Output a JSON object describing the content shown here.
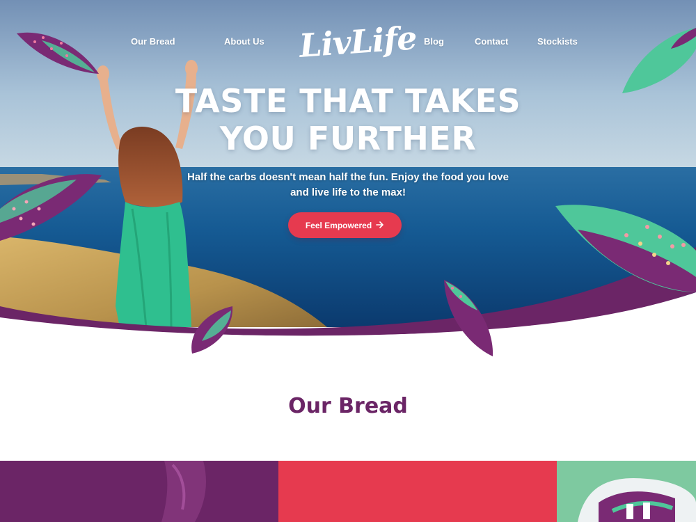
{
  "nav": {
    "left": [
      "Our Bread",
      "About Us"
    ],
    "logo": "LivLife",
    "right": [
      "Blog",
      "Contact",
      "Stockists"
    ]
  },
  "hero": {
    "headline_line1": "TASTE THAT TAKES",
    "headline_line2": "YOU FURTHER",
    "subtitle_line1": "Half the carbs doesn't mean half the fun. Enjoy the food you love",
    "subtitle_line2": "and live life to the max!",
    "cta_label": "Feel Empowered",
    "cta_icon": "arrow-right-icon"
  },
  "bread_section": {
    "title": "Our Bread"
  },
  "colors": {
    "brand_purple": "#6b2566",
    "accent_red": "#e63a4f",
    "leaf_green": "#4fc79a",
    "tile_purple": "#6b2566",
    "tile_red": "#e63a4f",
    "tile_green": "#7ec9a0"
  }
}
